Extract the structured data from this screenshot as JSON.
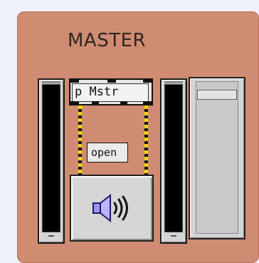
{
  "panel": {
    "title": "MASTER",
    "background_color": "#d08c72"
  },
  "object_box": {
    "text": "p Mstr"
  },
  "message_box": {
    "text": "open"
  },
  "speaker_button": {
    "icon": "speaker-icon"
  },
  "meters": {
    "left": {
      "level": 0
    },
    "right": {
      "level": 0
    }
  },
  "volume_slider": {
    "value": 0.95
  },
  "colors": {
    "cable_stripe": "#f5d200",
    "meter_well": "#000000"
  }
}
